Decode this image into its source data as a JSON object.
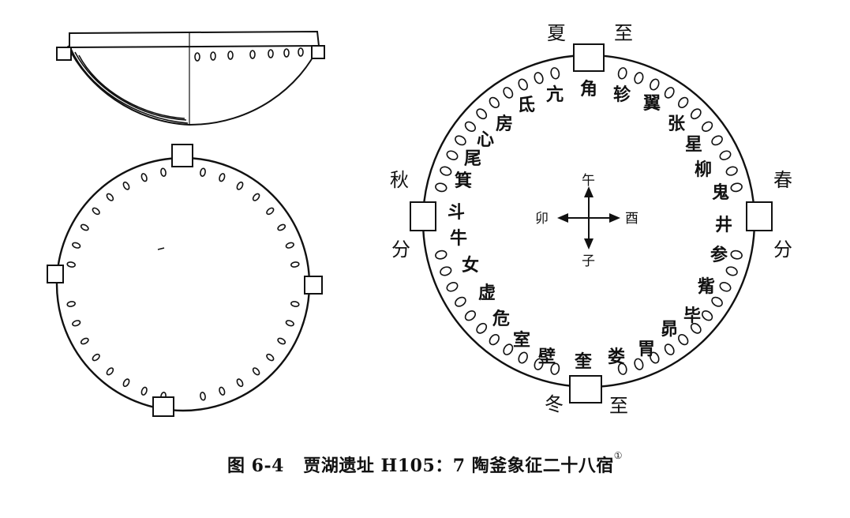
{
  "left_figure": {
    "bowl_profile_label": "side view of pottery basin",
    "top_view_label": "top view of pottery basin"
  },
  "right_figure": {
    "seasons": {
      "summer_solstice": [
        "夏",
        "至"
      ],
      "winter_solstice": [
        "冬",
        "至"
      ],
      "spring_equinox": [
        "春",
        "分"
      ],
      "autumn_equinox": [
        "秋",
        "分"
      ]
    },
    "compass": {
      "north": "午",
      "south": "子",
      "west": "卯",
      "east": "酉"
    },
    "mansions": [
      "亢",
      "角",
      "轸",
      "翼",
      "张",
      "星",
      "柳",
      "鬼",
      "井",
      "参",
      "觜",
      "毕",
      "昴",
      "胃",
      "娄",
      "奎",
      "壁",
      "室",
      "危",
      "虚",
      "女",
      "牛",
      "斗",
      "箕",
      "尾",
      "心",
      "房",
      "氐"
    ]
  },
  "caption": {
    "prefix": "图 6-4",
    "text": "贾湖遗址 H105：7 陶釜象征二十八宿",
    "footnote": "①"
  }
}
